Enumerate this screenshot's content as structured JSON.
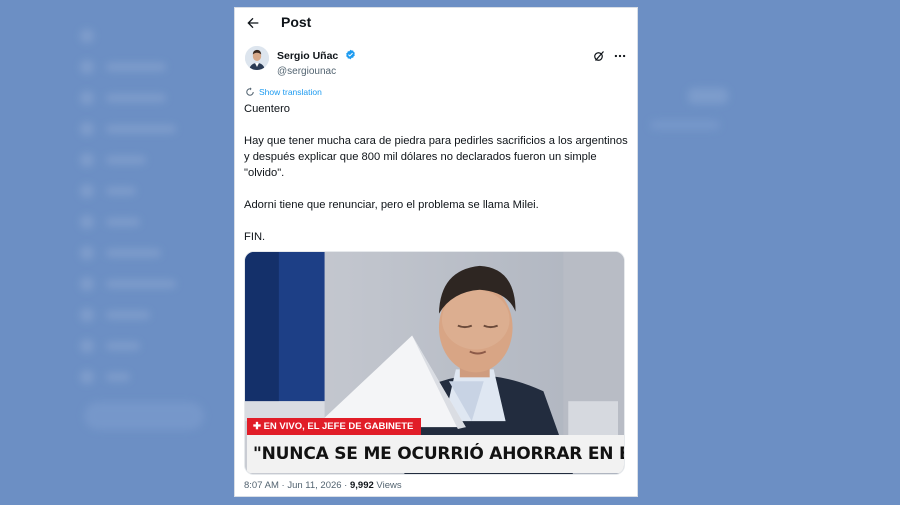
{
  "header": {
    "title": "Post"
  },
  "author": {
    "name": "Sergio Uñac",
    "handle": "@sergiounac"
  },
  "translate": {
    "label": "Show translation"
  },
  "post": {
    "paragraphs": [
      "Cuentero",
      "Hay que tener mucha cara de piedra para pedirles sacrificios a los argentinos y después explicar que 800 mil dólares no declarados fueron un simple \"olvido\".",
      "Adorni tiene que renunciar, pero el problema se llama Milei.",
      "FIN."
    ]
  },
  "media": {
    "chyron_top": "✚ EN VIVO, EL JEFE DE GABINETE",
    "chyron_main": "\"NUNCA SE ME OCURRIÓ AHORRAR EN BLANCO\""
  },
  "meta": {
    "time": "8:07 AM",
    "separator": " · ",
    "date": "Jun 11, 2026",
    "views": "9,992",
    "views_label": "Views"
  },
  "colors": {
    "link": "#1d9bf0",
    "verified": "#1d9bf0",
    "chyron_red": "#e11d28",
    "background": "#6c8fc4"
  },
  "icons": [
    "back-arrow-icon",
    "verified-badge-icon",
    "grok-icon",
    "more-icon",
    "translate-icon"
  ]
}
